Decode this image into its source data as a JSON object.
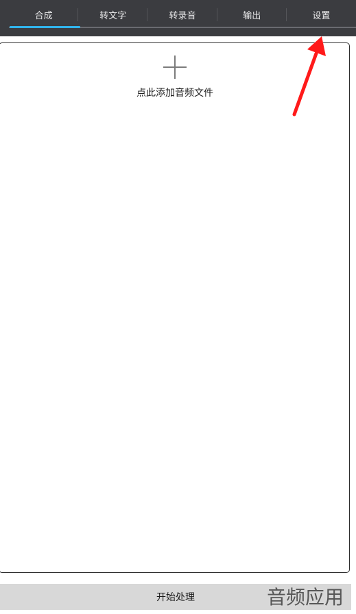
{
  "tabs": [
    {
      "label": "合成",
      "active": true
    },
    {
      "label": "转文字",
      "active": false
    },
    {
      "label": "转录音",
      "active": false
    },
    {
      "label": "输出",
      "active": false
    },
    {
      "label": "设置",
      "active": false
    }
  ],
  "dropzone": {
    "add_label": "点此添加音频文件",
    "icon": "plus-icon"
  },
  "bottom": {
    "start_label": "开始处理"
  },
  "watermark": "音频应用",
  "colors": {
    "tabbar_bg": "#3b3c40",
    "active_accent": "#31b4ec",
    "annotation_arrow": "#ff1a1a"
  }
}
